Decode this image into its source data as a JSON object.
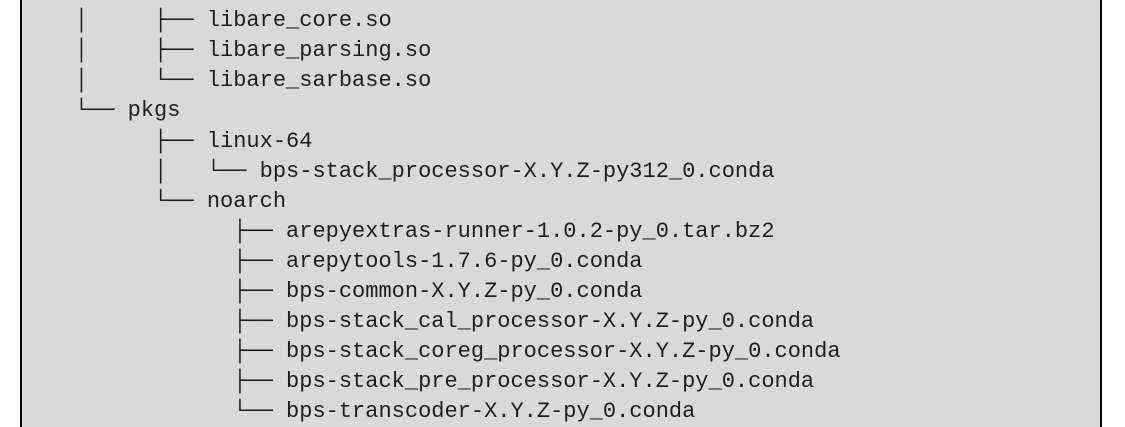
{
  "tree": {
    "lines": [
      "    │     ├── libare_core.so",
      "    │     ├── libare_parsing.so",
      "    │     └── libare_sarbase.so",
      "    └── pkgs",
      "          ├── linux-64",
      "          │   └── bps-stack_processor-X.Y.Z-py312_0.conda",
      "          └── noarch",
      "                ├── arepyextras-runner-1.0.2-py_0.tar.bz2",
      "                ├── arepytools-1.7.6-py_0.conda",
      "                ├── bps-common-X.Y.Z-py_0.conda",
      "                ├── bps-stack_cal_processor-X.Y.Z-py_0.conda",
      "                ├── bps-stack_coreg_processor-X.Y.Z-py_0.conda",
      "                ├── bps-stack_pre_processor-X.Y.Z-py_0.conda",
      "                └── bps-transcoder-X.Y.Z-py_0.conda"
    ]
  }
}
